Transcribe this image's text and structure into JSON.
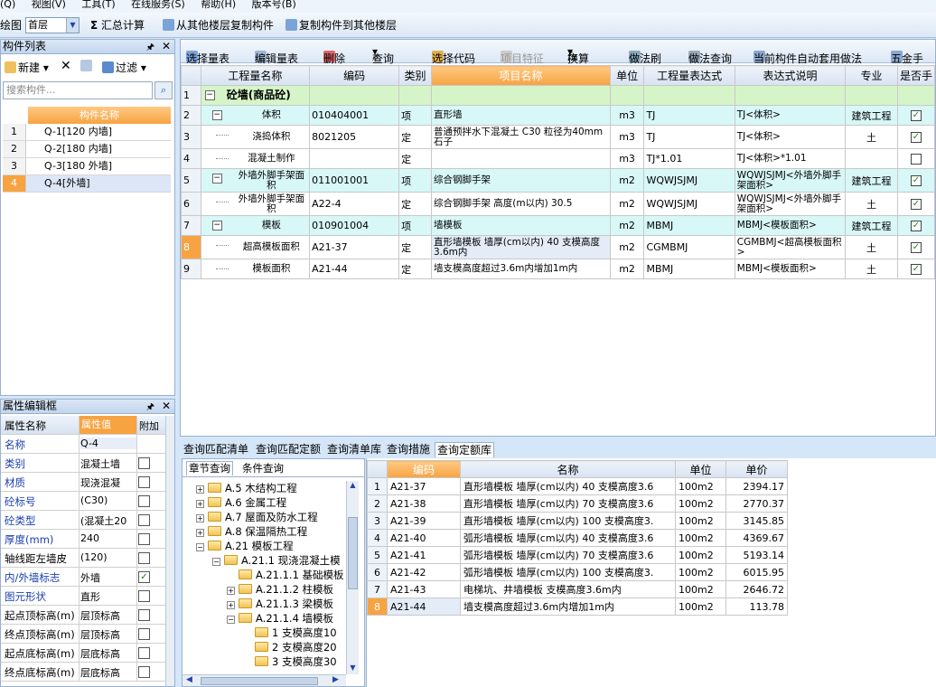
{
  "menu": [
    "(Q)",
    "视图(V)",
    "工具(T)",
    "在线服务(S)",
    "帮助(H)",
    "版本号(B)"
  ],
  "toolbar": {
    "floor_label": "绘图",
    "floor_value": "首层",
    "sum_label": "汇总计算",
    "copy_from": "从其他楼层复制构件",
    "copy_to": "复制构件到其他楼层"
  },
  "comp_list": {
    "title": "构件列表",
    "new": "新建",
    "filter": "过滤",
    "search_placeholder": "搜索构件...",
    "header": "构件名称",
    "rows": [
      {
        "n": "1",
        "t": "Q-1[120 内墙]"
      },
      {
        "n": "2",
        "t": "Q-2[180 内墙]"
      },
      {
        "n": "3",
        "t": "Q-3[180 外墙]"
      },
      {
        "n": "4",
        "t": "Q-4[外墙]"
      }
    ]
  },
  "props": {
    "title": "属性编辑框",
    "h_name": "属性名称",
    "h_value": "属性值",
    "h_add": "附加",
    "rows": [
      {
        "k": "名称",
        "v": "Q-4",
        "c": "",
        "blue": true
      },
      {
        "k": "类别",
        "v": "混凝土墙",
        "c": " ",
        "blue": true
      },
      {
        "k": "材质",
        "v": "现浇混凝",
        "c": " ",
        "blue": true
      },
      {
        "k": "砼标号",
        "v": "(C30)",
        "c": " ",
        "blue": true
      },
      {
        "k": "砼类型",
        "v": "(混凝土20",
        "c": " ",
        "blue": true
      },
      {
        "k": "厚度(mm)",
        "v": "240",
        "c": " ",
        "blue": true
      },
      {
        "k": "轴线距左墙皮",
        "v": "(120)",
        "c": " ",
        "blue": false
      },
      {
        "k": "内/外墙标志",
        "v": "外墙",
        "c": "✓",
        "blue": true
      },
      {
        "k": "图元形状",
        "v": "直形",
        "c": " ",
        "blue": true
      },
      {
        "k": "起点顶标高(m)",
        "v": "层顶标高",
        "c": " ",
        "blue": false
      },
      {
        "k": "终点顶标高(m)",
        "v": "层顶标高",
        "c": " ",
        "blue": false
      },
      {
        "k": "起点底标高(m)",
        "v": "层底标高",
        "c": " ",
        "blue": false
      },
      {
        "k": "终点底标高(m)",
        "v": "层底标高",
        "c": " ",
        "blue": false
      }
    ]
  },
  "main_toolbar": [
    "选择量表",
    "编辑量表",
    "删除",
    "查询",
    "选择代码",
    "项目特征",
    "换算",
    "做法刷",
    "做法查询",
    "当前构件自动套用做法",
    "五金手"
  ],
  "grid": {
    "headers": [
      "",
      "工程量名称",
      "编码",
      "类别",
      "项目名称",
      "单位",
      "工程量表达式",
      "表达式说明",
      "专业",
      "是否手"
    ],
    "rows": [
      {
        "n": "1",
        "name": "砼墙(商品砼)",
        "code": "",
        "cat": "",
        "proj": "",
        "unit": "",
        "expr": "",
        "desc": "",
        "major": "",
        "chk": "",
        "cls": "green",
        "box": "−"
      },
      {
        "n": "2",
        "name": "体积",
        "code": "010404001",
        "cat": "项",
        "proj": "直形墙",
        "unit": "m3",
        "expr": "TJ",
        "desc": "TJ<体积>",
        "major": "建筑工程",
        "chk": "✓",
        "cls": "cyan",
        "box": "−"
      },
      {
        "n": "3",
        "name": "浇捣体积",
        "code": "8021205",
        "cat": "定",
        "proj": "普通预拌水下混凝土 C30 粒径为40mm石子",
        "unit": "m3",
        "expr": "TJ",
        "desc": "TJ<体积>",
        "major": "土",
        "chk": "✓",
        "cls": "",
        "box": ""
      },
      {
        "n": "4",
        "name": "混凝土制作",
        "code": "",
        "cat": "定",
        "proj": "",
        "unit": "m3",
        "expr": "TJ*1.01",
        "desc": "TJ<体积>*1.01",
        "major": "",
        "chk": " ",
        "cls": "",
        "box": ""
      },
      {
        "n": "5",
        "name": "外墙外脚手架面积",
        "code": "011001001",
        "cat": "项",
        "proj": "综合钢脚手架",
        "unit": "m2",
        "expr": "WQWJSJMJ",
        "desc": "WQWJSJMJ<外墙外脚手架面积>",
        "major": "建筑工程",
        "chk": "✓",
        "cls": "cyan",
        "box": "−"
      },
      {
        "n": "6",
        "name": "外墙外脚手架面积",
        "code": "A22-4",
        "cat": "定",
        "proj": "综合钢脚手架 高度(m以内) 30.5",
        "unit": "m2",
        "expr": "WQWJSJMJ",
        "desc": "WQWJSJMJ<外墙外脚手架面积>",
        "major": "土",
        "chk": "✓",
        "cls": "",
        "box": ""
      },
      {
        "n": "7",
        "name": "模板",
        "code": "010901004",
        "cat": "项",
        "proj": "墙模板",
        "unit": "m2",
        "expr": "MBMJ",
        "desc": "MBMJ<模板面积>",
        "major": "建筑工程",
        "chk": "✓",
        "cls": "cyan",
        "box": "−"
      },
      {
        "n": "8",
        "name": "超高模板面积",
        "code": "A21-37",
        "cat": "定",
        "proj": "直形墙模板 墙厚(cm以内) 40 支模高度3.6m内",
        "unit": "m2",
        "expr": "CGMBMJ",
        "desc": "CGMBMJ<超高模板面积>",
        "major": "土",
        "chk": "✓",
        "cls": "",
        "box": ""
      },
      {
        "n": "9",
        "name": "模板面积",
        "code": "A21-44",
        "cat": "定",
        "proj": "墙支模高度超过3.6m内增加1m内",
        "unit": "m2",
        "expr": "MBMJ",
        "desc": "MBMJ<模板面积>",
        "major": "土",
        "chk": "✓",
        "cls": "",
        "box": ""
      }
    ]
  },
  "bottom_tabs": [
    "查询匹配清单",
    "查询匹配定额",
    "查询清单库",
    "查询措施",
    "查询定额库"
  ],
  "tree": {
    "tab1": "章节查询",
    "tab2": "条件查询",
    "nodes": [
      {
        "t": "A.5 木结构工程",
        "pm": "+",
        "lvl": 0
      },
      {
        "t": "A.6 金属工程",
        "pm": "+",
        "lvl": 0
      },
      {
        "t": "A.7 屋面及防水工程",
        "pm": "+",
        "lvl": 0
      },
      {
        "t": "A.8 保温隔热工程",
        "pm": "+",
        "lvl": 0
      },
      {
        "t": "A.21 模板工程",
        "pm": "−",
        "lvl": 0
      },
      {
        "t": "A.21.1 现浇混凝土模",
        "pm": "−",
        "lvl": 1
      },
      {
        "t": "A.21.1.1 基础模板",
        "pm": "",
        "lvl": 2
      },
      {
        "t": "A.21.1.2 柱模板",
        "pm": "+",
        "lvl": 2
      },
      {
        "t": "A.21.1.3 梁模板",
        "pm": "+",
        "lvl": 2
      },
      {
        "t": "A.21.1.4 墙模板",
        "pm": "−",
        "lvl": 2
      },
      {
        "t": "1 支模高度10",
        "pm": "",
        "lvl": 3
      },
      {
        "t": "2 支模高度20",
        "pm": "",
        "lvl": 3
      },
      {
        "t": "3 支模高度30",
        "pm": "",
        "lvl": 3
      }
    ]
  },
  "quota": {
    "headers": [
      "",
      "编码",
      "名称",
      "单位",
      "单价"
    ],
    "rows": [
      {
        "n": "1",
        "code": "A21-37",
        "name": "直形墙模板 墙厚(cm以内) 40 支模高度3.6",
        "unit": "100m2",
        "price": "2394.17"
      },
      {
        "n": "2",
        "code": "A21-38",
        "name": "直形墙模板 墙厚(cm以内) 70 支模高度3.6",
        "unit": "100m2",
        "price": "2770.37"
      },
      {
        "n": "3",
        "code": "A21-39",
        "name": "直形墙模板 墙厚(cm以内) 100 支模高度3.",
        "unit": "100m2",
        "price": "3145.85"
      },
      {
        "n": "4",
        "code": "A21-40",
        "name": "弧形墙模板 墙厚(cm以内) 40 支模高度3.6",
        "unit": "100m2",
        "price": "4369.67"
      },
      {
        "n": "5",
        "code": "A21-41",
        "name": "弧形墙模板 墙厚(cm以内) 70 支模高度3.6",
        "unit": "100m2",
        "price": "5193.14"
      },
      {
        "n": "6",
        "code": "A21-42",
        "name": "弧形墙模板 墙厚(cm以内) 100 支模高度3.",
        "unit": "100m2",
        "price": "6015.95"
      },
      {
        "n": "7",
        "code": "A21-43",
        "name": "电梯坑、井墙模板 支模高度3.6m内",
        "unit": "100m2",
        "price": "2646.72"
      },
      {
        "n": "8",
        "code": "A21-44",
        "name": "墙支模高度超过3.6m内增加1m内",
        "unit": "100m2",
        "price": "113.78"
      }
    ]
  }
}
